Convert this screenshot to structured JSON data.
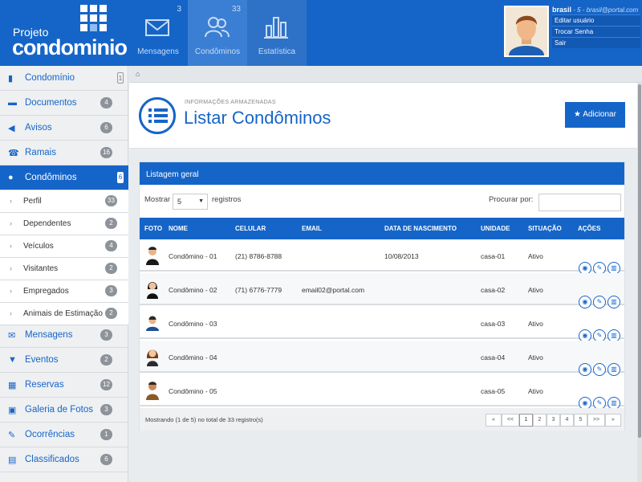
{
  "brand": {
    "line1": "Projeto",
    "line2": "condominio"
  },
  "topnav": [
    {
      "label": "Mensagens",
      "count": "3",
      "icon": "envelope-icon"
    },
    {
      "label": "Condôminos",
      "count": "33",
      "icon": "users-icon"
    },
    {
      "label": "Estatística",
      "count": "",
      "icon": "bar-chart-icon"
    }
  ],
  "user": {
    "name": "brasil",
    "detail": "- 5 - brasil@portal.com",
    "menu": [
      "Editar usuário",
      "Trocar Senha",
      "Sair"
    ]
  },
  "sidebar": {
    "items": [
      {
        "label": "Condomínio",
        "badge": "1",
        "icon": "building-icon"
      },
      {
        "label": "Documentos",
        "badge": "4",
        "icon": "folder-icon"
      },
      {
        "label": "Avisos",
        "badge": "6",
        "icon": "megaphone-icon"
      },
      {
        "label": "Ramais",
        "badge": "16",
        "icon": "phone-icon"
      },
      {
        "label": "Condôminos",
        "badge": "6",
        "icon": "users-icon"
      }
    ],
    "subitems": [
      {
        "label": "Perfil",
        "badge": "33"
      },
      {
        "label": "Dependentes",
        "badge": "2"
      },
      {
        "label": "Veículos",
        "badge": "4"
      },
      {
        "label": "Visitantes",
        "badge": "2"
      },
      {
        "label": "Empregados",
        "badge": "3"
      },
      {
        "label": "Animais de Estimação",
        "badge": "2"
      }
    ],
    "items2": [
      {
        "label": "Mensagens",
        "badge": "3",
        "icon": "envelope-icon"
      },
      {
        "label": "Eventos",
        "badge": "2",
        "icon": "glass-icon"
      },
      {
        "label": "Reservas",
        "badge": "12",
        "icon": "calendar-icon"
      },
      {
        "label": "Galeria de Fotos",
        "badge": "3",
        "icon": "image-icon"
      },
      {
        "label": "Ocorrências",
        "badge": "1",
        "icon": "edit-icon"
      },
      {
        "label": "Classificados",
        "badge": "6",
        "icon": "tag-icon"
      }
    ]
  },
  "page": {
    "small": "INFORMAÇÕES ARMAZENADAS",
    "title": "Listar Condôminos",
    "add_label": "★ Adicionar"
  },
  "panel": {
    "title": "Listagem geral",
    "show_label": "Mostrar",
    "show_value": "5",
    "records_label": "registros",
    "search_label": "Procurar por:"
  },
  "table": {
    "headers": [
      "FOTO",
      "NOME",
      "CELULAR",
      "EMAIL",
      "DATA DE NASCIMENTO",
      "UNIDADE",
      "SITUAÇÃO",
      "AÇÕES"
    ],
    "rows": [
      {
        "nome": "Condômino - 01",
        "celular": "(21) 8786-8788",
        "email": "",
        "nasc": "10/08/2013",
        "unidade": "casa-01",
        "situacao": "Ativo"
      },
      {
        "nome": "Condômino - 02",
        "celular": "(71) 6776-7779",
        "email": "email02@portal.com",
        "nasc": "",
        "unidade": "casa-02",
        "situacao": "Ativo"
      },
      {
        "nome": "Condômino - 03",
        "celular": "",
        "email": "",
        "nasc": "",
        "unidade": "casa-03",
        "situacao": "Ativo"
      },
      {
        "nome": "Condômino - 04",
        "celular": "",
        "email": "",
        "nasc": "",
        "unidade": "casa-04",
        "situacao": "Ativo"
      },
      {
        "nome": "Condômino - 05",
        "celular": "",
        "email": "",
        "nasc": "",
        "unidade": "casa-05",
        "situacao": "Ativo"
      }
    ]
  },
  "footer": {
    "info": "Mostrando (1 de 5) no total de 33 registro(s)",
    "pages": [
      "«",
      "<<",
      "1",
      "2",
      "3",
      "4",
      "5",
      ">>",
      "»"
    ]
  },
  "colors": {
    "primary": "#1565c8"
  }
}
